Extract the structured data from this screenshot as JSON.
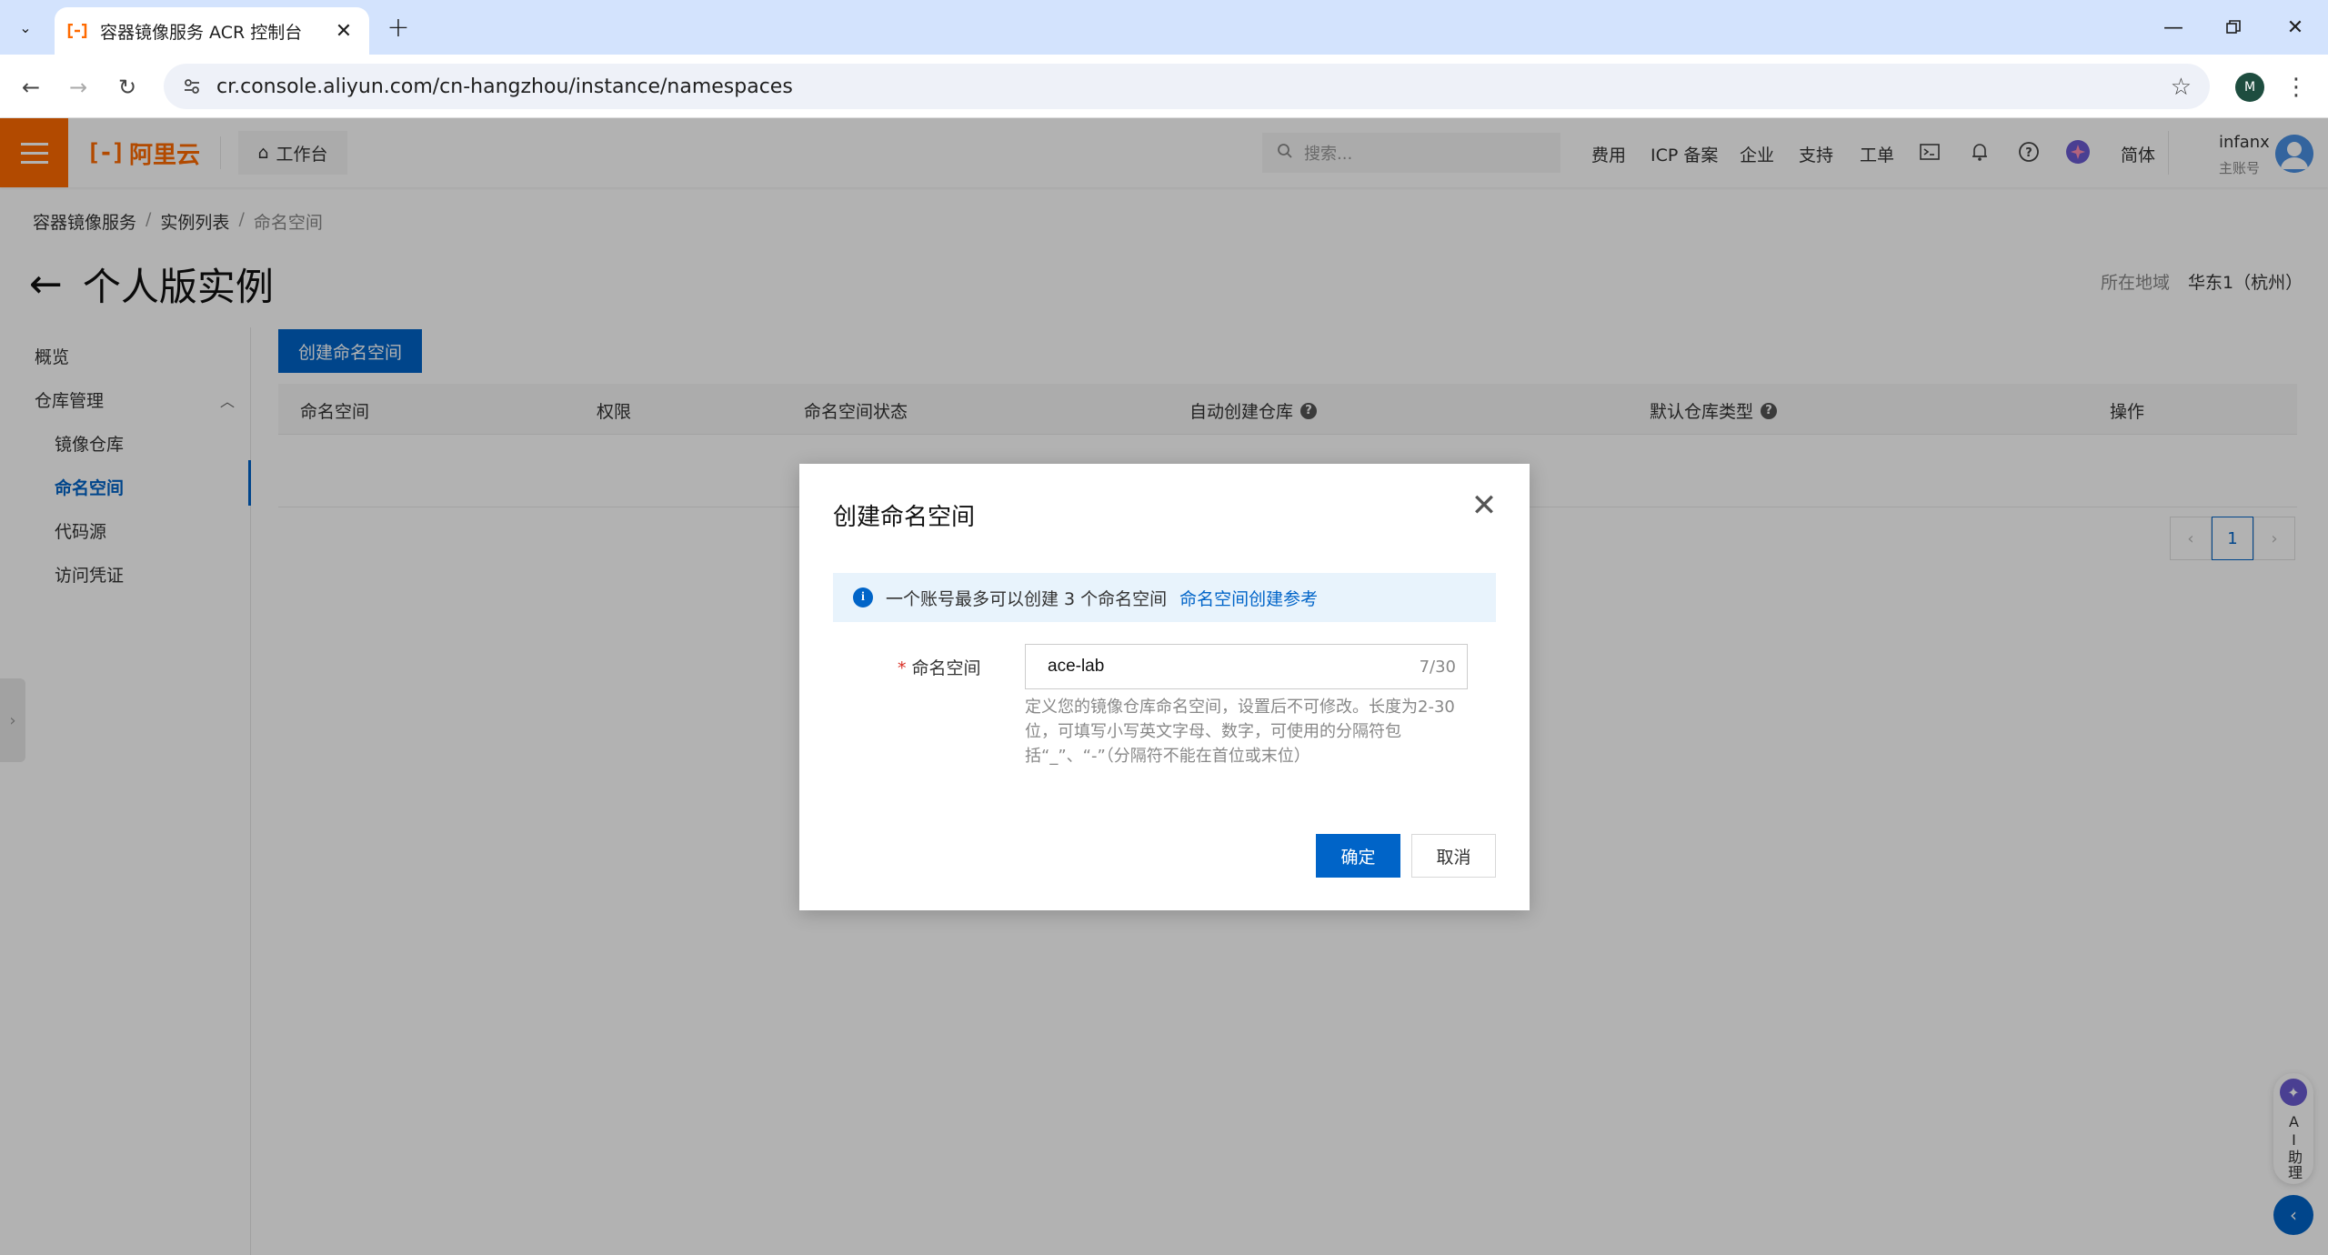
{
  "browser": {
    "tab_title": "容器镜像服务 ACR 控制台",
    "url": "cr.console.aliyun.com/cn-hangzhou/instance/namespaces",
    "profile_initial": "M"
  },
  "topbar": {
    "logo_text": "阿里云",
    "workbench": "工作台",
    "search_placeholder": "搜索...",
    "items": [
      "费用",
      "ICP 备案",
      "企业",
      "支持",
      "工单"
    ],
    "lang": "简体",
    "user_name": "infanx",
    "user_role": "主账号",
    "brand_color": "#ff6a00"
  },
  "breadcrumb": [
    "容器镜像服务",
    "实例列表",
    "命名空间"
  ],
  "page": {
    "title": "个人版实例",
    "region_label": "所在地域",
    "region_value": "华东1（杭州）"
  },
  "sidebar": {
    "overview": "概览",
    "repo_mgmt": "仓库管理",
    "items": [
      "镜像仓库",
      "命名空间",
      "代码源",
      "访问凭证"
    ],
    "active_index": 1
  },
  "main": {
    "create_button": "创建命名空间",
    "columns": [
      "命名空间",
      "权限",
      "命名空间状态",
      "自动创建仓库",
      "默认仓库类型",
      "操作"
    ],
    "page_number": "1"
  },
  "ai_assistant": {
    "label": "AI助理"
  },
  "modal": {
    "title": "创建命名空间",
    "notice_text": "一个账号最多可以创建 3 个命名空间",
    "notice_link": "命名空间创建参考",
    "field_label": "命名空间",
    "field_value": "ace-lab",
    "counter": "7/30",
    "help_text": "定义您的镜像仓库命名空间，设置后不可修改。长度为2-30位，可填写小写英文字母、数字，可使用的分隔符包括“_”、“-”（分隔符不能在首位或末位）",
    "ok_label": "确定",
    "cancel_label": "取消",
    "accent_color": "#0064c8"
  }
}
